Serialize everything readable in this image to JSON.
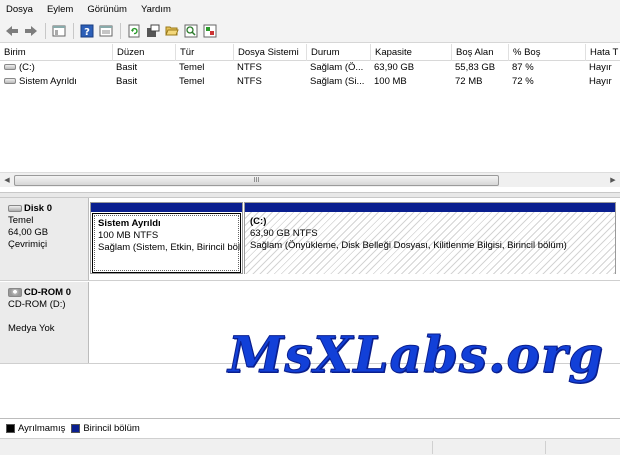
{
  "menu": [
    "Dosya",
    "Eylem",
    "Görünüm",
    "Yardım"
  ],
  "toolbar": {
    "icons": [
      "back-icon",
      "forward-icon",
      "console-tree-icon",
      "help-icon",
      "properties-icon",
      "refresh-icon",
      "settings-icon",
      "open-icon",
      "search-icon",
      "export-icon"
    ]
  },
  "volume_table": {
    "columns": [
      "Birim",
      "Düzen",
      "Tür",
      "Dosya Sistemi",
      "Durum",
      "Kapasite",
      "Boş Alan",
      "% Boş",
      "Hata T"
    ],
    "rows": [
      [
        "(C:)",
        "Basit",
        "Temel",
        "NTFS",
        "Sağlam (Ö...",
        "63,90 GB",
        "55,83 GB",
        "87 %",
        "Hayır"
      ],
      [
        "Sistem Ayrıldı",
        "Basit",
        "Temel",
        "NTFS",
        "Sağlam (Si...",
        "100 MB",
        "72 MB",
        "72 %",
        "Hayır"
      ]
    ]
  },
  "scrollbar": {
    "thumb_grip": "III"
  },
  "disks": [
    {
      "title": "Disk 0",
      "type": "Temel",
      "size": "64,00 GB",
      "status": "Çevrimiçi",
      "partitions": [
        {
          "name": "Sistem Ayrıldı",
          "size_fs": "100 MB NTFS",
          "status": "Sağlam (Sistem, Etkin, Birincil bölüm)"
        },
        {
          "name": "(C:)",
          "size_fs": "63,90 GB NTFS",
          "status": "Sağlam (Önyükleme, Disk Belleği Dosyası, Kilitlenme Bilgisi, Birincil bölüm)"
        }
      ]
    },
    {
      "title": "CD-ROM 0",
      "type": "CD-ROM (D:)",
      "status": "Medya Yok"
    }
  ],
  "watermark": "MsXLabs.org",
  "legend": [
    {
      "label": "Ayrılmamış",
      "color": "#000000"
    },
    {
      "label": "Birincil bölüm",
      "color": "#0a1f8f"
    }
  ]
}
